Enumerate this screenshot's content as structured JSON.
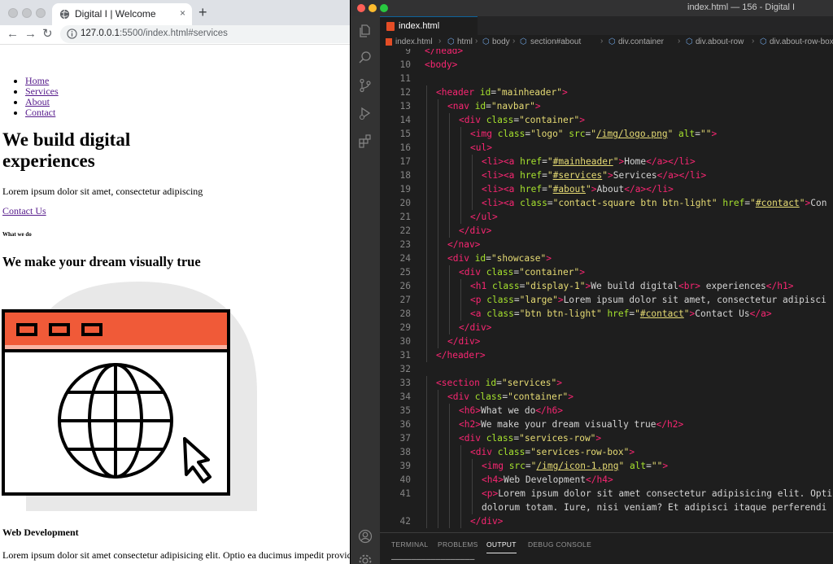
{
  "browser": {
    "tab_title": "Digital I | Welcome",
    "tab_close": "×",
    "new_tab": "+",
    "url_host": "127.0.0.1",
    "url_rest": ":5500/index.html#services",
    "page": {
      "nav": [
        "Home",
        "Services",
        "About",
        "Contact"
      ],
      "heading_line1": "We build digital",
      "heading_line2": "experiences",
      "lead": "Lorem ipsum dolor sit amet, consectetur adipiscing",
      "contact_link": "Contact Us",
      "h6": "What we do",
      "h2": "We make your dream visually true",
      "h4": "Web Development",
      "paragraph": "Lorem ipsum dolor sit amet consectetur adipisicing elit. Optio ea ducimus impedit provident,"
    },
    "colors": {
      "icon_orange": "#f05a38",
      "icon_circle": "#e8e8e8"
    }
  },
  "vscode": {
    "window_title": "index.html — 156 - Digital I",
    "tab": "index.html",
    "breadcrumbs": [
      "index.html",
      "html",
      "body",
      "section#about",
      "div.container",
      "div.about-row",
      "div.about-row-box"
    ],
    "lines": [
      {
        "n": "9",
        "i": 0,
        "t": [
          [
            "tag",
            "</head>"
          ]
        ]
      },
      {
        "n": "10",
        "i": 0,
        "t": [
          [
            "tag",
            "<body>"
          ]
        ]
      },
      {
        "n": "11",
        "i": 0,
        "t": []
      },
      {
        "n": "12",
        "i": 1,
        "t": [
          [
            "tag",
            "<header "
          ],
          [
            "attr",
            "id"
          ],
          [
            "punc",
            "="
          ],
          [
            "str",
            "\"mainheader\""
          ],
          [
            "tag",
            ">"
          ]
        ]
      },
      {
        "n": "13",
        "i": 2,
        "t": [
          [
            "tag",
            "<nav "
          ],
          [
            "attr",
            "id"
          ],
          [
            "punc",
            "="
          ],
          [
            "str",
            "\"navbar\""
          ],
          [
            "tag",
            ">"
          ]
        ]
      },
      {
        "n": "14",
        "i": 3,
        "t": [
          [
            "tag",
            "<div "
          ],
          [
            "attr",
            "class"
          ],
          [
            "punc",
            "="
          ],
          [
            "str",
            "\"container\""
          ],
          [
            "tag",
            ">"
          ]
        ]
      },
      {
        "n": "15",
        "i": 4,
        "t": [
          [
            "tag",
            "<img "
          ],
          [
            "attr",
            "class"
          ],
          [
            "punc",
            "="
          ],
          [
            "str",
            "\"logo\" "
          ],
          [
            "attr",
            "src"
          ],
          [
            "punc",
            "="
          ],
          [
            "str",
            "\""
          ],
          [
            "strlink",
            "/img/logo.png"
          ],
          [
            "str",
            "\" "
          ],
          [
            "attr",
            "alt"
          ],
          [
            "punc",
            "="
          ],
          [
            "str",
            "\"\""
          ],
          [
            "tag",
            ">"
          ]
        ]
      },
      {
        "n": "16",
        "i": 4,
        "t": [
          [
            "tag",
            "<ul>"
          ]
        ]
      },
      {
        "n": "17",
        "i": 5,
        "t": [
          [
            "tag",
            "<li><a "
          ],
          [
            "attr",
            "href"
          ],
          [
            "punc",
            "="
          ],
          [
            "str",
            "\""
          ],
          [
            "strlink",
            "#mainheader"
          ],
          [
            "str",
            "\""
          ],
          [
            "tag",
            ">"
          ],
          [
            "punc",
            "Home"
          ],
          [
            "tag",
            "</a></li>"
          ]
        ]
      },
      {
        "n": "18",
        "i": 5,
        "t": [
          [
            "tag",
            "<li><a "
          ],
          [
            "attr",
            "href"
          ],
          [
            "punc",
            "="
          ],
          [
            "str",
            "\""
          ],
          [
            "strlink",
            "#services"
          ],
          [
            "str",
            "\""
          ],
          [
            "tag",
            ">"
          ],
          [
            "punc",
            "Services"
          ],
          [
            "tag",
            "</a></li>"
          ]
        ]
      },
      {
        "n": "19",
        "i": 5,
        "t": [
          [
            "tag",
            "<li><a "
          ],
          [
            "attr",
            "href"
          ],
          [
            "punc",
            "="
          ],
          [
            "str",
            "\""
          ],
          [
            "strlink",
            "#about"
          ],
          [
            "str",
            "\""
          ],
          [
            "tag",
            ">"
          ],
          [
            "punc",
            "About"
          ],
          [
            "tag",
            "</a></li>"
          ]
        ]
      },
      {
        "n": "20",
        "i": 5,
        "t": [
          [
            "tag",
            "<li><a "
          ],
          [
            "attr",
            "class"
          ],
          [
            "punc",
            "="
          ],
          [
            "str",
            "\"contact-square btn btn-light\" "
          ],
          [
            "attr",
            "href"
          ],
          [
            "punc",
            "="
          ],
          [
            "str",
            "\""
          ],
          [
            "strlink",
            "#contact"
          ],
          [
            "str",
            "\""
          ],
          [
            "tag",
            ">"
          ],
          [
            "punc",
            "Con"
          ]
        ]
      },
      {
        "n": "21",
        "i": 4,
        "t": [
          [
            "tag",
            "</ul>"
          ]
        ]
      },
      {
        "n": "22",
        "i": 3,
        "t": [
          [
            "tag",
            "</div>"
          ]
        ]
      },
      {
        "n": "23",
        "i": 2,
        "t": [
          [
            "tag",
            "</nav>"
          ]
        ]
      },
      {
        "n": "24",
        "i": 2,
        "t": [
          [
            "tag",
            "<div "
          ],
          [
            "attr",
            "id"
          ],
          [
            "punc",
            "="
          ],
          [
            "str",
            "\"showcase\""
          ],
          [
            "tag",
            ">"
          ]
        ]
      },
      {
        "n": "25",
        "i": 3,
        "t": [
          [
            "tag",
            "<div "
          ],
          [
            "attr",
            "class"
          ],
          [
            "punc",
            "="
          ],
          [
            "str",
            "\"container\""
          ],
          [
            "tag",
            ">"
          ]
        ]
      },
      {
        "n": "26",
        "i": 4,
        "t": [
          [
            "tag",
            "<h1 "
          ],
          [
            "attr",
            "class"
          ],
          [
            "punc",
            "="
          ],
          [
            "str",
            "\"display-1\""
          ],
          [
            "tag",
            ">"
          ],
          [
            "punc",
            "We build digital"
          ],
          [
            "tag",
            "<br>"
          ],
          [
            "punc",
            " experiences"
          ],
          [
            "tag",
            "</h1>"
          ]
        ]
      },
      {
        "n": "27",
        "i": 4,
        "t": [
          [
            "tag",
            "<p "
          ],
          [
            "attr",
            "class"
          ],
          [
            "punc",
            "="
          ],
          [
            "str",
            "\"large\""
          ],
          [
            "tag",
            ">"
          ],
          [
            "punc",
            "Lorem ipsum dolor sit amet, consectetur adipisci"
          ]
        ]
      },
      {
        "n": "28",
        "i": 4,
        "t": [
          [
            "tag",
            "<a "
          ],
          [
            "attr",
            "class"
          ],
          [
            "punc",
            "="
          ],
          [
            "str",
            "\"btn btn-light\" "
          ],
          [
            "attr",
            "href"
          ],
          [
            "punc",
            "="
          ],
          [
            "str",
            "\""
          ],
          [
            "strlink",
            "#contact"
          ],
          [
            "str",
            "\""
          ],
          [
            "tag",
            ">"
          ],
          [
            "punc",
            "Contact Us"
          ],
          [
            "tag",
            "</a>"
          ]
        ]
      },
      {
        "n": "29",
        "i": 3,
        "t": [
          [
            "tag",
            "</div>"
          ]
        ]
      },
      {
        "n": "30",
        "i": 2,
        "t": [
          [
            "tag",
            "</div>"
          ]
        ]
      },
      {
        "n": "31",
        "i": 1,
        "t": [
          [
            "tag",
            "</header>"
          ]
        ]
      },
      {
        "n": "32",
        "i": 0,
        "t": []
      },
      {
        "n": "33",
        "i": 1,
        "t": [
          [
            "tag",
            "<section "
          ],
          [
            "attr",
            "id"
          ],
          [
            "punc",
            "="
          ],
          [
            "str",
            "\"services\""
          ],
          [
            "tag",
            ">"
          ]
        ]
      },
      {
        "n": "34",
        "i": 2,
        "t": [
          [
            "tag",
            "<div "
          ],
          [
            "attr",
            "class"
          ],
          [
            "punc",
            "="
          ],
          [
            "str",
            "\"container\""
          ],
          [
            "tag",
            ">"
          ]
        ]
      },
      {
        "n": "35",
        "i": 3,
        "t": [
          [
            "tag",
            "<h6>"
          ],
          [
            "punc",
            "What we do"
          ],
          [
            "tag",
            "</h6>"
          ]
        ]
      },
      {
        "n": "36",
        "i": 3,
        "t": [
          [
            "tag",
            "<h2>"
          ],
          [
            "punc",
            "We make your dream visually true"
          ],
          [
            "tag",
            "</h2>"
          ]
        ]
      },
      {
        "n": "37",
        "i": 3,
        "t": [
          [
            "tag",
            "<div "
          ],
          [
            "attr",
            "class"
          ],
          [
            "punc",
            "="
          ],
          [
            "str",
            "\"services-row\""
          ],
          [
            "tag",
            ">"
          ]
        ]
      },
      {
        "n": "38",
        "i": 4,
        "t": [
          [
            "tag",
            "<div "
          ],
          [
            "attr",
            "class"
          ],
          [
            "punc",
            "="
          ],
          [
            "str",
            "\"services-row-box\""
          ],
          [
            "tag",
            ">"
          ]
        ]
      },
      {
        "n": "39",
        "i": 5,
        "t": [
          [
            "tag",
            "<img "
          ],
          [
            "attr",
            "src"
          ],
          [
            "punc",
            "="
          ],
          [
            "str",
            "\""
          ],
          [
            "strlink",
            "/img/icon-1.png"
          ],
          [
            "str",
            "\" "
          ],
          [
            "attr",
            "alt"
          ],
          [
            "punc",
            "="
          ],
          [
            "str",
            "\"\""
          ],
          [
            "tag",
            ">"
          ]
        ]
      },
      {
        "n": "40",
        "i": 5,
        "t": [
          [
            "tag",
            "<h4>"
          ],
          [
            "punc",
            "Web Development"
          ],
          [
            "tag",
            "</h4>"
          ]
        ]
      },
      {
        "n": "41",
        "i": 5,
        "t": [
          [
            "tag",
            "<p>"
          ],
          [
            "punc",
            "Lorem ipsum dolor sit amet consectetur adipisicing elit. Opti"
          ]
        ]
      },
      {
        "n": "",
        "i": 5,
        "t": [
          [
            "punc",
            "dolorum totam. Iure, nisi veniam? Et adipisci itaque perferendi"
          ]
        ]
      },
      {
        "n": "42",
        "i": 4,
        "t": [
          [
            "tag",
            "</div>"
          ]
        ]
      }
    ],
    "panel_tabs": [
      "TERMINAL",
      "PROBLEMS",
      "OUTPUT",
      "DEBUG CONSOLE"
    ],
    "panel_output": "—————————————————",
    "colors": {
      "tag": "#f92672",
      "attr": "#a6e22e",
      "string": "#e6db74"
    }
  }
}
